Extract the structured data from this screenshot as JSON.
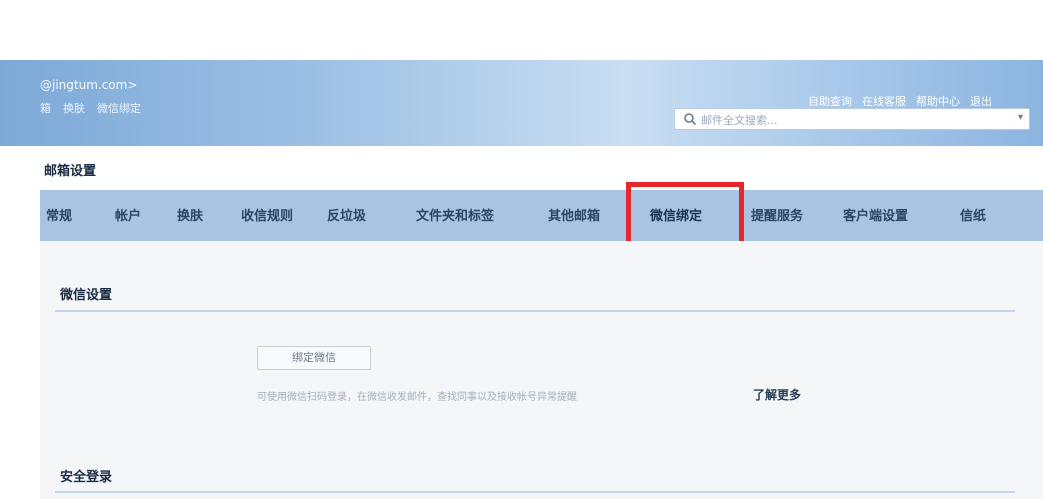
{
  "header": {
    "email_partial": "@jingtum.com>",
    "sub_links": [
      "箱",
      "换肤",
      "微信绑定"
    ],
    "top_links": [
      "自助查询",
      "在线客服",
      "帮助中心",
      "退出"
    ]
  },
  "search": {
    "placeholder": "邮件全文搜索..."
  },
  "settings": {
    "title": "邮箱设置",
    "tabs": [
      "常规",
      "帐户",
      "换肤",
      "收信规则",
      "反垃圾",
      "文件夹和标签",
      "其他邮箱",
      "微信绑定",
      "提醒服务",
      "客户端设置",
      "信纸"
    ],
    "active_tab": "微信绑定"
  },
  "wechat": {
    "section_title": "微信设置",
    "bind_button": "绑定微信",
    "description": "可使用微信扫码登录，在微信收发邮件，查找同事以及接收帐号异常提醒",
    "learn_more": "了解更多"
  },
  "security": {
    "section_title": "安全登录"
  },
  "colors": {
    "highlight": "#e5272b",
    "tabbar": "#a9c4e3",
    "header": "#9cc0e4"
  }
}
